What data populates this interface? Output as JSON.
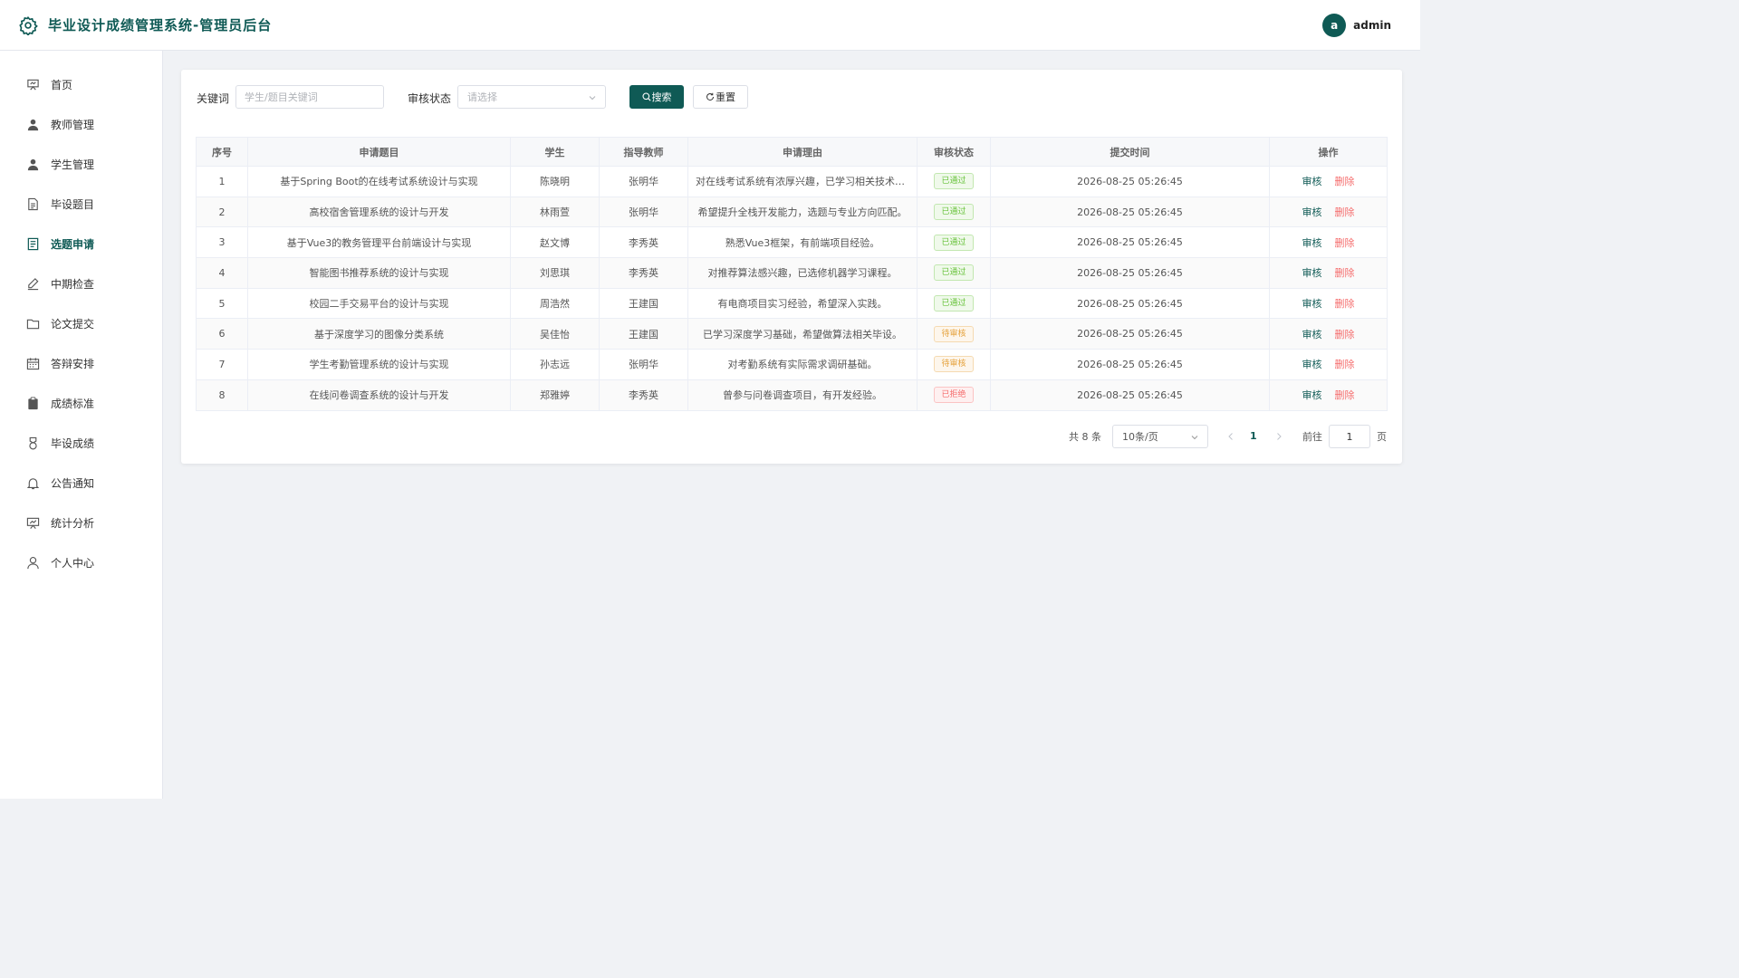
{
  "header": {
    "title": "毕业设计成绩管理系统-管理员后台",
    "user": {
      "avatar_letter": "a",
      "name": "admin"
    }
  },
  "sidebar": {
    "items": [
      {
        "label": "首页",
        "icon": "presentation-icon",
        "active": false
      },
      {
        "label": "教师管理",
        "icon": "user-filled-icon",
        "active": false
      },
      {
        "label": "学生管理",
        "icon": "user-filled-icon",
        "active": false
      },
      {
        "label": "毕设题目",
        "icon": "document-icon",
        "active": false
      },
      {
        "label": "选题申请",
        "icon": "document-list-icon",
        "active": true
      },
      {
        "label": "中期检查",
        "icon": "edit-pen-icon",
        "active": false
      },
      {
        "label": "论文提交",
        "icon": "folder-icon",
        "active": false
      },
      {
        "label": "答辩安排",
        "icon": "calendar-icon",
        "active": false
      },
      {
        "label": "成绩标准",
        "icon": "clipboard-icon",
        "active": false
      },
      {
        "label": "毕设成绩",
        "icon": "medal-icon",
        "active": false
      },
      {
        "label": "公告通知",
        "icon": "bell-icon",
        "active": false
      },
      {
        "label": "统计分析",
        "icon": "data-board-icon",
        "active": false
      },
      {
        "label": "个人中心",
        "icon": "user-outline-icon",
        "active": false
      }
    ]
  },
  "filters": {
    "keyword_label": "关键词",
    "keyword_placeholder": "学生/题目关键词",
    "keyword_value": "",
    "status_label": "审核状态",
    "status_placeholder": "请选择",
    "search_label": "搜索",
    "reset_label": "重置"
  },
  "table": {
    "columns": [
      "序号",
      "申请题目",
      "学生",
      "指导教师",
      "申请理由",
      "审核状态",
      "提交时间",
      "操作"
    ],
    "rows": [
      {
        "no": "1",
        "title": "基于Spring Boot的在线考试系统设计与实现",
        "student": "陈晓明",
        "teacher": "张明华",
        "reason": "对在线考试系统有浓厚兴趣，已学习相关技术栈。",
        "status": "已通过",
        "status_type": "ok",
        "time": "2026-08-25 05:26:45"
      },
      {
        "no": "2",
        "title": "高校宿舍管理系统的设计与开发",
        "student": "林雨萱",
        "teacher": "张明华",
        "reason": "希望提升全栈开发能力，选题与专业方向匹配。",
        "status": "已通过",
        "status_type": "ok",
        "time": "2026-08-25 05:26:45"
      },
      {
        "no": "3",
        "title": "基于Vue3的教务管理平台前端设计与实现",
        "student": "赵文博",
        "teacher": "李秀英",
        "reason": "熟悉Vue3框架，有前端项目经验。",
        "status": "已通过",
        "status_type": "ok",
        "time": "2026-08-25 05:26:45"
      },
      {
        "no": "4",
        "title": "智能图书推荐系统的设计与实现",
        "student": "刘思琪",
        "teacher": "李秀英",
        "reason": "对推荐算法感兴趣，已选修机器学习课程。",
        "status": "已通过",
        "status_type": "ok",
        "time": "2026-08-25 05:26:45"
      },
      {
        "no": "5",
        "title": "校园二手交易平台的设计与实现",
        "student": "周浩然",
        "teacher": "王建国",
        "reason": "有电商项目实习经验，希望深入实践。",
        "status": "已通过",
        "status_type": "ok",
        "time": "2026-08-25 05:26:45"
      },
      {
        "no": "6",
        "title": "基于深度学习的图像分类系统",
        "student": "吴佳怡",
        "teacher": "王建国",
        "reason": "已学习深度学习基础，希望做算法相关毕设。",
        "status": "待审核",
        "status_type": "pending",
        "time": "2026-08-25 05:26:45"
      },
      {
        "no": "7",
        "title": "学生考勤管理系统的设计与实现",
        "student": "孙志远",
        "teacher": "张明华",
        "reason": "对考勤系统有实际需求调研基础。",
        "status": "待审核",
        "status_type": "pending",
        "time": "2026-08-25 05:26:45"
      },
      {
        "no": "8",
        "title": "在线问卷调查系统的设计与开发",
        "student": "郑雅婷",
        "teacher": "李秀英",
        "reason": "曾参与问卷调查项目，有开发经验。",
        "status": "已拒绝",
        "status_type": "reject",
        "time": "2026-08-25 05:26:45"
      }
    ],
    "action_review": "审核",
    "action_delete": "删除"
  },
  "pagination": {
    "total_text": "共 8 条",
    "page_size": "10条/页",
    "current_page": "1",
    "goto_label": "前往",
    "goto_value": "1",
    "page_suffix": "页"
  },
  "colors": {
    "brand": "#0f5a55",
    "approved": "#67c23a",
    "pending": "#e6a23c",
    "rejected": "#f56c6c"
  }
}
